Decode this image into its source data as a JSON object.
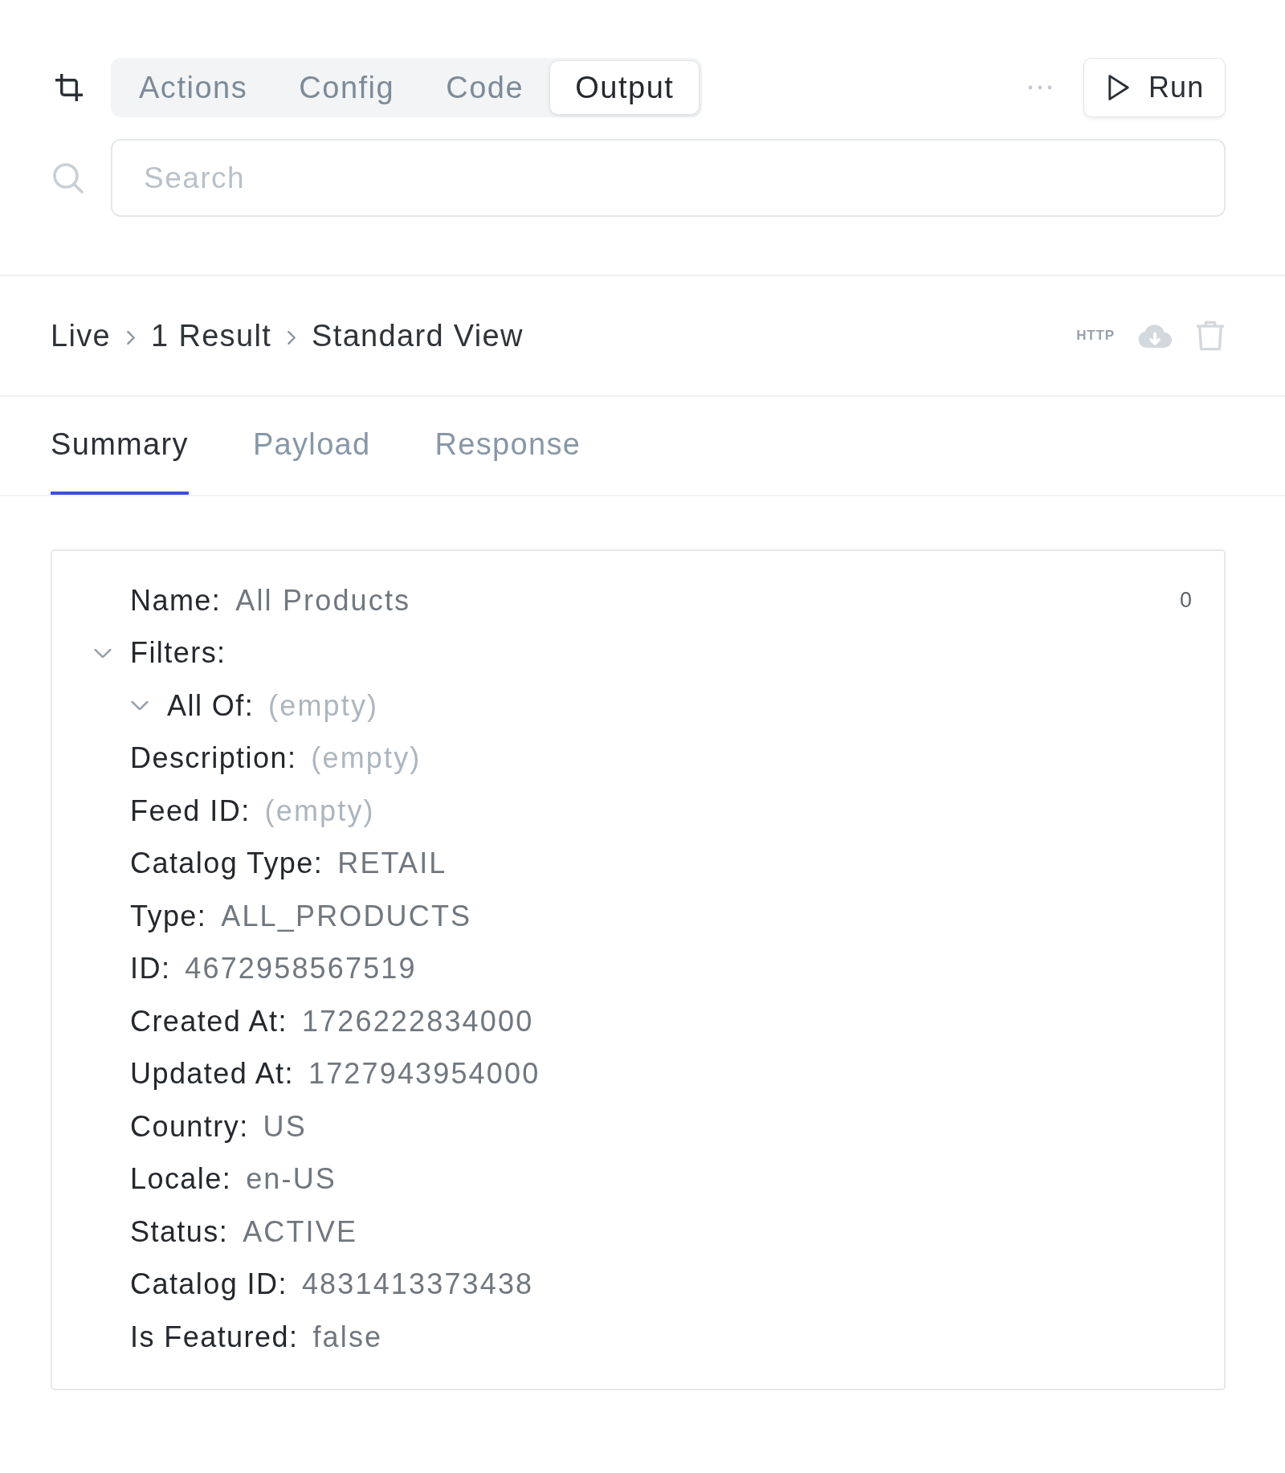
{
  "toolbar": {
    "tabs": [
      {
        "label": "Actions",
        "selected": false
      },
      {
        "label": "Config",
        "selected": false
      },
      {
        "label": "Code",
        "selected": false
      },
      {
        "label": "Output",
        "selected": true
      }
    ],
    "run_button": {
      "label": "Run"
    }
  },
  "search": {
    "placeholder": "Search"
  },
  "breadcrumb": {
    "items": [
      "Live",
      "1 Result",
      "Standard View"
    ],
    "actions": [
      {
        "kind": "http",
        "label": "HTTP",
        "disabled": true
      },
      {
        "kind": "download",
        "disabled": true
      },
      {
        "kind": "delete",
        "disabled": true
      }
    ]
  },
  "tabs": [
    {
      "label": "Summary",
      "selected": true
    },
    {
      "label": "Payload",
      "selected": false
    },
    {
      "label": "Response",
      "selected": false
    }
  ],
  "summary": {
    "index": "0",
    "items": [
      {
        "kind": "field",
        "label": "Name:",
        "value": "All Products",
        "empty": false
      },
      {
        "kind": "group",
        "label": "Filters:",
        "expanded": true,
        "children": [
          {
            "kind": "group",
            "label": "All Of:",
            "value": "(empty)",
            "empty": true,
            "expanded": true
          }
        ]
      },
      {
        "kind": "field",
        "label": "Description:",
        "value": "(empty)",
        "empty": true
      },
      {
        "kind": "field",
        "label": "Feed ID:",
        "value": "(empty)",
        "empty": true
      },
      {
        "kind": "field",
        "label": "Catalog Type:",
        "value": "RETAIL",
        "empty": false
      },
      {
        "kind": "field",
        "label": "Type:",
        "value": "ALL_PRODUCTS",
        "empty": false
      },
      {
        "kind": "field",
        "label": "ID:",
        "value": "4672958567519",
        "empty": false
      },
      {
        "kind": "field",
        "label": "Created At:",
        "value": "1726222834000",
        "empty": false
      },
      {
        "kind": "field",
        "label": "Updated At:",
        "value": "1727943954000",
        "empty": false
      },
      {
        "kind": "field",
        "label": "Country:",
        "value": "US",
        "empty": false
      },
      {
        "kind": "field",
        "label": "Locale:",
        "value": "en-US",
        "empty": false
      },
      {
        "kind": "field",
        "label": "Status:",
        "value": "ACTIVE",
        "empty": false
      },
      {
        "kind": "field",
        "label": "Catalog ID:",
        "value": "4831413373438",
        "empty": false
      },
      {
        "kind": "field",
        "label": "Is Featured:",
        "value": "false",
        "empty": false
      }
    ]
  }
}
